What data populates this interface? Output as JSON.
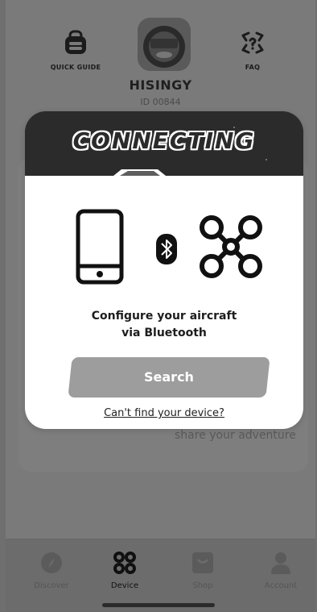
{
  "header": {
    "quick_guide_label": "QUICK GUIDE",
    "faq_label": "FAQ",
    "device_name": "HISINGY",
    "device_id": "ID 00844"
  },
  "background": {
    "share_text": "share your adventure"
  },
  "modal": {
    "title": "CONNECTING",
    "line1": "Configure your aircraft",
    "line2": "via Bluetooth",
    "search_label": "Search",
    "cant_find_label": "Can't find your device?"
  },
  "tabs": [
    {
      "label": "Discover",
      "icon": "compass-icon",
      "active": false
    },
    {
      "label": "Device",
      "icon": "grid-icon",
      "active": true
    },
    {
      "label": "Shop",
      "icon": "bag-icon",
      "active": false
    },
    {
      "label": "Account",
      "icon": "person-icon",
      "active": false
    }
  ],
  "colors": {
    "overlay": "#7a7a7a",
    "modal_bg": "#ffffff",
    "header_dark": "#2b2b2b",
    "button_gray": "#9d9d9d"
  }
}
